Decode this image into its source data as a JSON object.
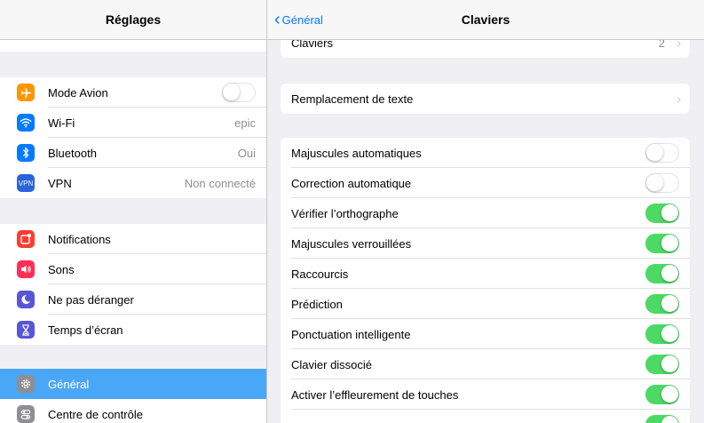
{
  "sidebar": {
    "title": "Réglages",
    "group1": [
      {
        "label": "Mode Avion",
        "value": "",
        "icon": "airplane-icon",
        "color": "#ff9500",
        "toggle": "off"
      },
      {
        "label": "Wi-Fi",
        "value": "epic",
        "icon": "wifi-icon",
        "color": "#007aff"
      },
      {
        "label": "Bluetooth",
        "value": "Oui",
        "icon": "bluetooth-icon",
        "color": "#007aff"
      },
      {
        "label": "VPN",
        "value": "Non connecté",
        "icon": "vpn-icon",
        "color": "#2a63d9",
        "icon_text": "VPN"
      }
    ],
    "group2": [
      {
        "label": "Notifications",
        "icon": "notifications-icon",
        "color": "#ff3b30"
      },
      {
        "label": "Sons",
        "icon": "sounds-icon",
        "color": "#ff2d55"
      },
      {
        "label": "Ne pas déranger",
        "icon": "moon-icon",
        "color": "#5856d6"
      },
      {
        "label": "Temps d’écran",
        "icon": "hourglass-icon",
        "color": "#5856d6"
      }
    ],
    "group3": [
      {
        "label": "Général",
        "icon": "gear-icon",
        "color": "#8e8e93",
        "active": true
      },
      {
        "label": "Centre de contrôle",
        "icon": "control-center-icon",
        "color": "#8e8e93"
      }
    ]
  },
  "nav": {
    "back_label": "Général",
    "title": "Claviers"
  },
  "keyboards_row": {
    "label": "Claviers",
    "value": "2"
  },
  "text_replacement": {
    "label": "Remplacement de texte"
  },
  "settings": [
    {
      "label": "Majuscules automatiques",
      "state": "off"
    },
    {
      "label": "Correction automatique",
      "state": "off"
    },
    {
      "label": "Vérifier l’orthographe",
      "state": "on"
    },
    {
      "label": "Majuscules verrouillées",
      "state": "on"
    },
    {
      "label": "Raccourcis",
      "state": "on"
    },
    {
      "label": "Prédiction",
      "state": "on"
    },
    {
      "label": "Ponctuation intelligente",
      "state": "on"
    },
    {
      "label": "Clavier dissocié",
      "state": "on"
    },
    {
      "label": "Activer l’effleurement de touches",
      "state": "on"
    },
    {
      "label": "",
      "state": "on"
    }
  ],
  "colors": {
    "accent": "#007aff",
    "toggle_on": "#4cd964",
    "selection": "#4aa6f7"
  }
}
